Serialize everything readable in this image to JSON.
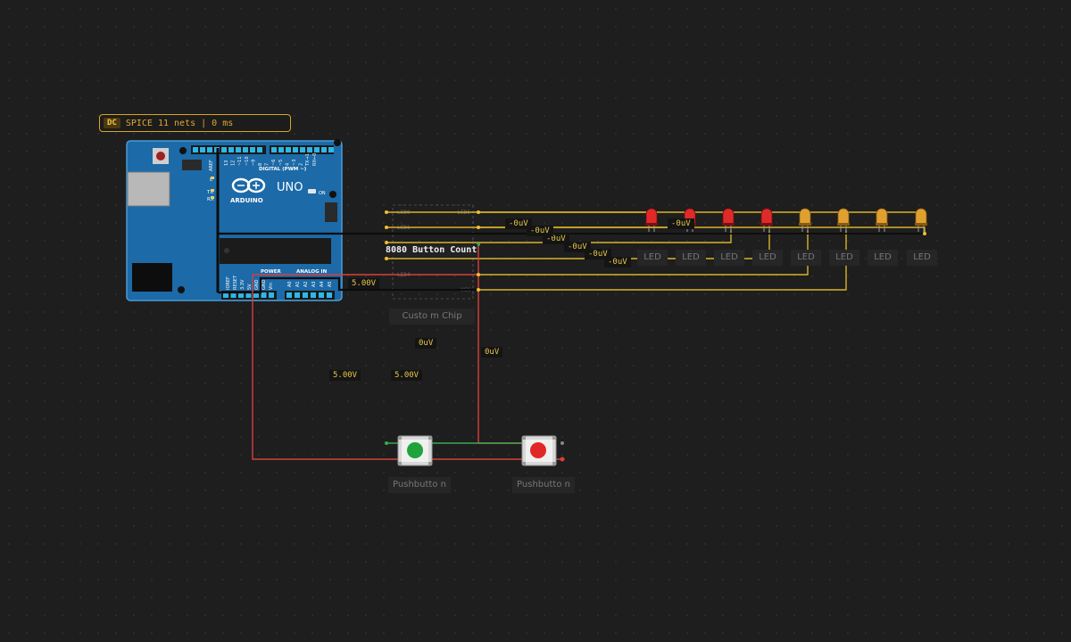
{
  "status": {
    "badge": "DC",
    "text": "SPICE 11 nets | 0 ms"
  },
  "arduino": {
    "model": "UNO",
    "brand": "ARDUINO",
    "on_label": "ON",
    "digital_header": "DIGITAL (PWM ~)",
    "power_header": "POWER",
    "analog_header": "ANALOG IN",
    "tx": "TX",
    "rx": "RX",
    "l": "L",
    "aref": "AREF",
    "digital_pins": [
      "13",
      "12",
      "~11",
      "~10",
      "~9",
      "8",
      "7",
      "~6",
      "~5",
      "4",
      "~3",
      "2",
      "TX→1",
      "RX←0"
    ],
    "power_pins": [
      "IOREF",
      "RESET",
      "3.3V",
      "5V",
      "GND",
      "GND",
      "Vin"
    ],
    "analog_pins": [
      "A0",
      "A1",
      "A2",
      "A3",
      "A4",
      "A5"
    ]
  },
  "chip": {
    "title": "8080 Button Count",
    "label": "Custo m Chip",
    "pin_labels_left": [
      "LED0",
      "LED1",
      "",
      "",
      "LED4",
      ""
    ],
    "pin_labels_right": [
      "LED5",
      "",
      "",
      "",
      "",
      "VCC"
    ]
  },
  "leds": [
    {
      "label": "LED",
      "color": "red"
    },
    {
      "label": "LED",
      "color": "red"
    },
    {
      "label": "LED",
      "color": "red"
    },
    {
      "label": "LED",
      "color": "red"
    },
    {
      "label": "LED",
      "color": "orange"
    },
    {
      "label": "LED",
      "color": "orange"
    },
    {
      "label": "LED",
      "color": "orange"
    },
    {
      "label": "LED",
      "color": "orange"
    }
  ],
  "buttons": [
    {
      "label": "Pushbutto n",
      "color": "green"
    },
    {
      "label": "Pushbutto n",
      "color": "red"
    }
  ],
  "voltages": [
    "-0uV",
    "-0uV",
    "-0uV",
    "-0uV",
    "-0uV",
    "-0uV",
    "-0uV",
    "5.00V",
    "0uV",
    "0uV",
    "5.00V",
    "5.00V"
  ],
  "colors": {
    "wire_yellow": "#d8b32a",
    "wire_red": "#d8403a",
    "wire_green": "#3aa853",
    "wire_black": "#0c0c0c",
    "board": "#1c6aa8",
    "accent": "#d9a520"
  }
}
